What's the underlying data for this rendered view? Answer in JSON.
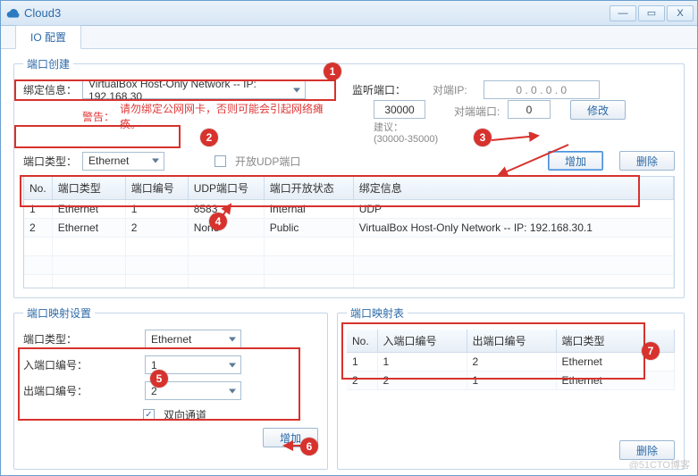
{
  "window": {
    "title": "Cloud3"
  },
  "tabs": {
    "active": "IO 配置"
  },
  "port_create": {
    "legend": "端口创建",
    "binding_label": "绑定信息：",
    "binding_dropdown": "VirtualBox Host-Only Network -- IP: 192.168.30",
    "warning_label": "警告：",
    "warning_text": "请勿绑定公网网卡，否则可能会引起网络瘫痪。",
    "port_type_label": "端口类型：",
    "port_type_value": "Ethernet",
    "open_udp_label": "开放UDP端口",
    "listen_port_label": "监听端口：",
    "listen_port_value": "30000",
    "listen_port_hint_label": "建议：",
    "listen_port_hint": "(30000-35000)",
    "peer_ip_label": "对端IP:",
    "peer_ip_value": "0 . 0 . 0 . 0",
    "peer_port_label": "对端端口:",
    "peer_port_value": "0",
    "modify_btn": "修改",
    "add_btn": "增加",
    "delete_btn": "删除",
    "table": {
      "headers": [
        "No.",
        "端口类型",
        "端口编号",
        "UDP端口号",
        "端口开放状态",
        "绑定信息"
      ],
      "rows": [
        {
          "no": "1",
          "type": "Ethernet",
          "num": "1",
          "udp": "8583",
          "state": "Internal",
          "bind": "UDP"
        },
        {
          "no": "2",
          "type": "Ethernet",
          "num": "2",
          "udp": "None",
          "state": "Public",
          "bind": "VirtualBox Host-Only Network -- IP: 192.168.30.1"
        }
      ],
      "blank_rows": 4
    }
  },
  "port_map": {
    "legend": "端口映射设置",
    "port_type_label": "端口类型：",
    "port_type_value": "Ethernet",
    "in_port_label": "入端口编号：",
    "in_port_value": "1",
    "out_port_label": "出端口编号：",
    "out_port_value": "2",
    "bidir_label": "双向通道",
    "add_btn": "增加"
  },
  "map_table": {
    "legend": "端口映射表",
    "headers": [
      "No.",
      "入端口编号",
      "出端口编号",
      "端口类型"
    ],
    "rows": [
      {
        "no": "1",
        "in": "1",
        "out": "2",
        "type": "Ethernet"
      },
      {
        "no": "2",
        "in": "2",
        "out": "1",
        "type": "Ethernet"
      }
    ],
    "delete_btn": "删除"
  },
  "annotations": {
    "markers": {
      "1": "1",
      "2": "2",
      "3": "3",
      "4": "4",
      "5": "5",
      "6": "6",
      "7": "7"
    }
  },
  "watermark": "@51CTO博客"
}
